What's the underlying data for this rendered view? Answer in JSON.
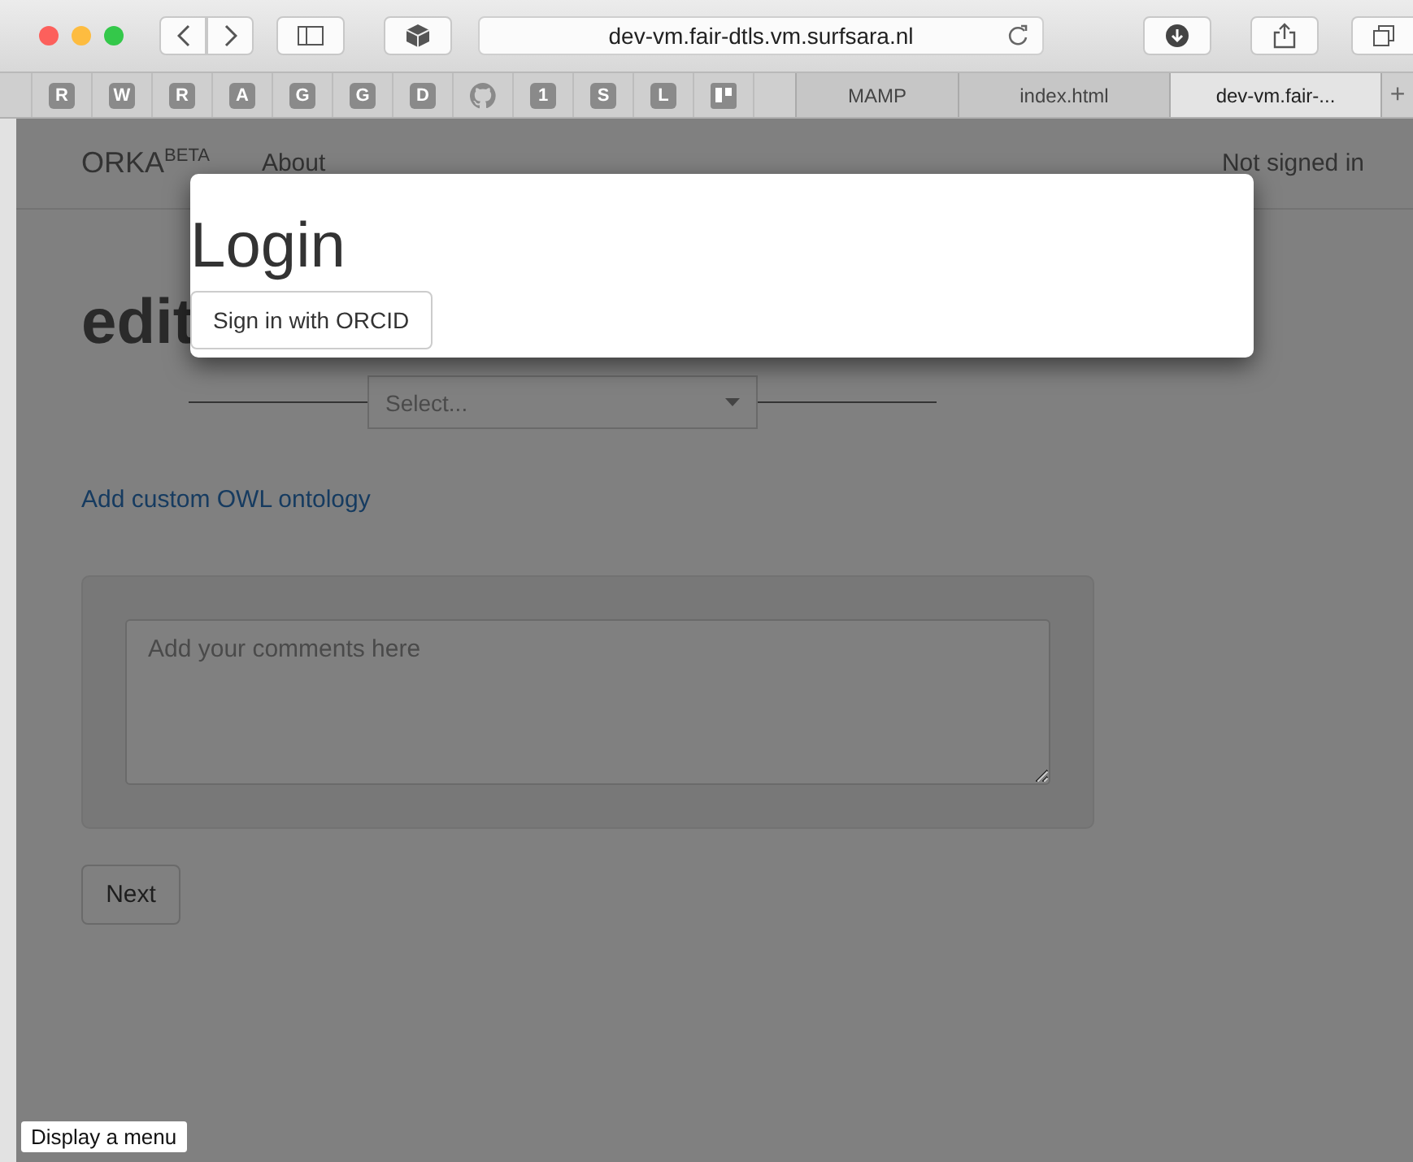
{
  "browser": {
    "address": "dev-vm.fair-dtls.vm.surfsara.nl",
    "bookmarks": [
      {
        "kind": "letter",
        "label": "R"
      },
      {
        "kind": "letter",
        "label": "W"
      },
      {
        "kind": "letter",
        "label": "R"
      },
      {
        "kind": "letter",
        "label": "A"
      },
      {
        "kind": "letter",
        "label": "G"
      },
      {
        "kind": "letter",
        "label": "G"
      },
      {
        "kind": "letter",
        "label": "D"
      },
      {
        "kind": "github"
      },
      {
        "kind": "letter",
        "label": "1"
      },
      {
        "kind": "letter",
        "label": "S"
      },
      {
        "kind": "letter",
        "label": "L"
      },
      {
        "kind": "board"
      }
    ],
    "tabs": [
      {
        "label": "MAMP",
        "selected": false
      },
      {
        "label": "index.html",
        "selected": false
      },
      {
        "label": "dev-vm.fair-...",
        "selected": true
      }
    ],
    "new_tab": "+"
  },
  "navbar": {
    "brand": "ORKA$^{BETA}$",
    "links": [
      "About"
    ],
    "status": "Not signed in"
  },
  "page": {
    "heading": "edit",
    "select": {
      "placeholder": "Select..."
    },
    "link": "Add custom OWL ontology",
    "comments": {
      "placeholder": "Add your comments here"
    },
    "next": "Next"
  },
  "modal": {
    "title": "Login",
    "button": "Sign in with ORCID"
  },
  "tooltip": "Display a menu"
}
